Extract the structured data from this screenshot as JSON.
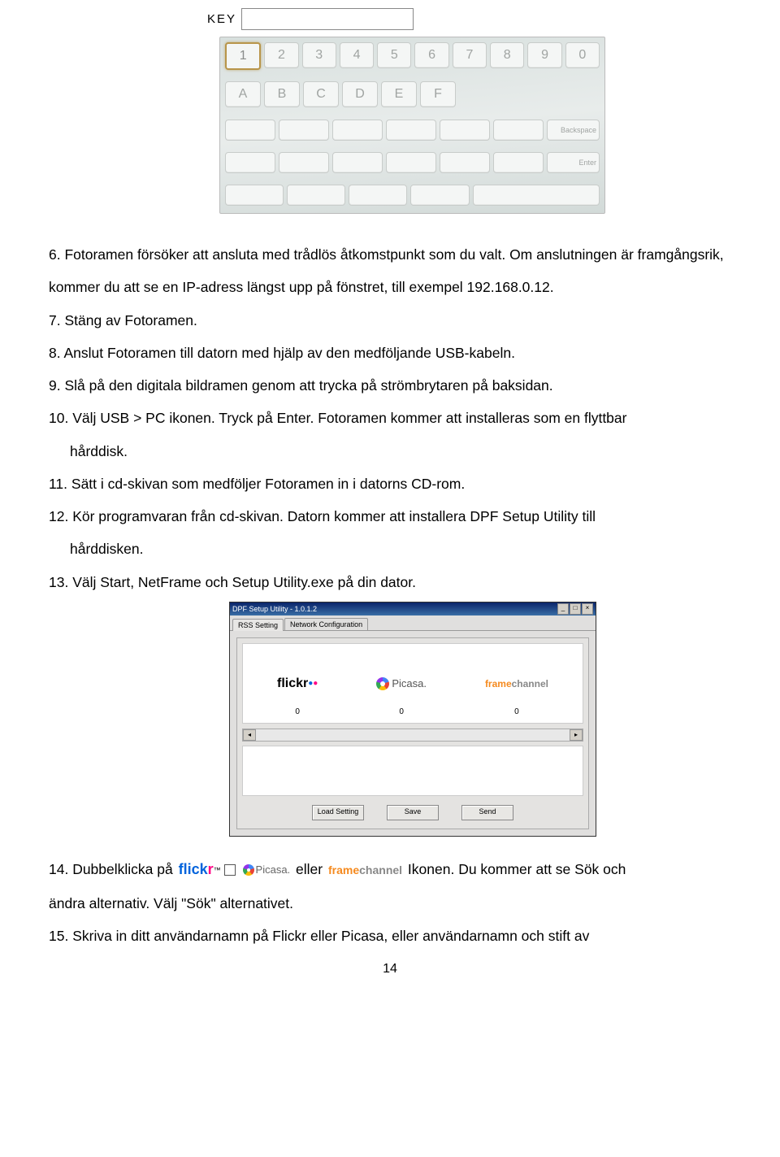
{
  "key_label": "KEY",
  "keyboard": {
    "row_numbers": [
      "1",
      "2",
      "3",
      "4",
      "5",
      "6",
      "7",
      "8",
      "9",
      "0"
    ],
    "row_letters": [
      "A",
      "B",
      "C",
      "D",
      "E",
      "F"
    ],
    "backspace": "Backspace",
    "enter": "Enter"
  },
  "paragraphs": {
    "p6": "6. Fotoramen försöker att ansluta med trådlös åtkomstpunkt som du valt. Om anslutningen är framgångsrik, kommer du att se en IP-adress längst upp på fönstret, till exempel 192.168.0.12.",
    "p7": "7. Stäng av Fotoramen.",
    "p8": "8. Anslut Fotoramen till datorn med hjälp av den medföljande USB-kabeln.",
    "p9": "9. Slå på den digitala bildramen genom att trycka på strömbrytaren på baksidan.",
    "p10a": "10. Välj USB > PC ikonen. Tryck på Enter. Fotoramen kommer att installeras som en flyttbar",
    "p10b": "hårddisk.",
    "p11": "11. Sätt i cd-skivan som medföljer Fotoramen in i datorns CD-rom.",
    "p12a": "12. Kör programvaran från cd-skivan. Datorn kommer att installera DPF Setup Utility till",
    "p12b": "hårddisken.",
    "p13": "13. Välj Start, NetFrame och Setup Utility.exe på din dator.",
    "p14a": "14. Dubbelklicka på",
    "p14b": "eller",
    "p14c": "Ikonen. Du kommer att se Sök och",
    "p14d": "ändra alternativ. Välj \"Sök\" alternativet.",
    "p15": "15. Skriva in ditt användarnamn på Flickr eller Picasa, eller användarnamn och stift av"
  },
  "screenshot": {
    "title": "DPF Setup Utility - 1.0.1.2",
    "tabs": [
      "RSS Setting",
      "Network Configuration"
    ],
    "services": {
      "flickr": {
        "name": "flickr",
        "count": "0"
      },
      "picasa": {
        "name": "Picasa.",
        "count": "0"
      },
      "framechannel": {
        "name_a": "frame",
        "name_b": "channel",
        "count": "0"
      }
    },
    "buttons": {
      "load": "Load Setting",
      "save": "Save",
      "send": "Send"
    }
  },
  "inline_picasa": "Picasa.",
  "inline_fc_a": "frame",
  "inline_fc_b": "channel",
  "page_number": "14"
}
